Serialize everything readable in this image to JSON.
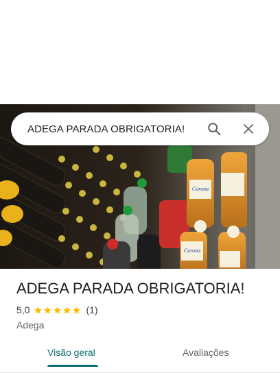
{
  "search": {
    "query": "ADEGA PARADA OBRIGATORIA!",
    "search_icon": "search-icon",
    "close_icon": "close-icon"
  },
  "place": {
    "name": "ADEGA PARADA OBRIGATORIA!",
    "rating": "5,0",
    "stars": 5,
    "review_count": "(1)",
    "category": "Adega"
  },
  "tabs": [
    {
      "label": "Visão geral",
      "active": true
    },
    {
      "label": "Avaliações",
      "active": false
    }
  ],
  "colors": {
    "accent": "#0b6e6e",
    "star": "#fbbc04",
    "text": "#202124"
  }
}
